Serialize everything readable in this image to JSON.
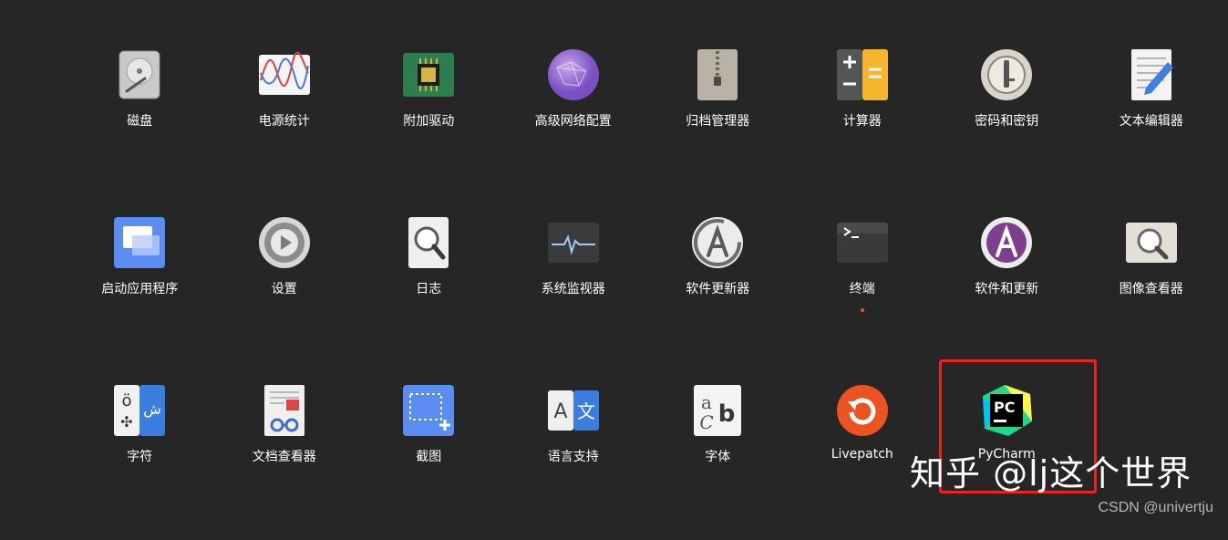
{
  "apps": [
    {
      "id": "disks",
      "label": "磁盘",
      "icon": "disk-icon"
    },
    {
      "id": "power-statistics",
      "label": "电源统计",
      "icon": "power-statistics-icon"
    },
    {
      "id": "additional-drivers",
      "label": "附加驱动",
      "icon": "chip-icon"
    },
    {
      "id": "advanced-network",
      "label": "高级网络配置",
      "icon": "network-globe-icon"
    },
    {
      "id": "archive-manager",
      "label": "归档管理器",
      "icon": "archive-zip-icon"
    },
    {
      "id": "calculator",
      "label": "计算器",
      "icon": "calculator-icon"
    },
    {
      "id": "passwords-keys",
      "label": "密码和密钥",
      "icon": "keyring-icon"
    },
    {
      "id": "text-editor",
      "label": "文本编辑器",
      "icon": "text-editor-icon"
    },
    {
      "id": "startup-apps",
      "label": "启动应用程序",
      "icon": "startup-windows-icon"
    },
    {
      "id": "settings",
      "label": "设置",
      "icon": "settings-gear-icon"
    },
    {
      "id": "logs",
      "label": "日志",
      "icon": "log-magnifier-icon"
    },
    {
      "id": "system-monitor",
      "label": "系统监视器",
      "icon": "system-monitor-icon"
    },
    {
      "id": "software-updater",
      "label": "软件更新器",
      "icon": "software-updater-icon"
    },
    {
      "id": "terminal",
      "label": "终端",
      "icon": "terminal-icon",
      "running": true
    },
    {
      "id": "software-updates",
      "label": "软件和更新",
      "icon": "software-updates-icon"
    },
    {
      "id": "image-viewer",
      "label": "图像查看器",
      "icon": "image-viewer-icon"
    },
    {
      "id": "characters",
      "label": "字符",
      "icon": "characters-icon"
    },
    {
      "id": "document-viewer",
      "label": "文档查看器",
      "icon": "document-viewer-icon"
    },
    {
      "id": "screenshot",
      "label": "截图",
      "icon": "screenshot-icon"
    },
    {
      "id": "language-support",
      "label": "语言支持",
      "icon": "language-icon"
    },
    {
      "id": "fonts",
      "label": "字体",
      "icon": "fonts-icon"
    },
    {
      "id": "livepatch",
      "label": "Livepatch",
      "icon": "livepatch-icon"
    },
    {
      "id": "pycharm",
      "label": "PyCharm",
      "icon": "pycharm-icon",
      "highlighted": true
    }
  ],
  "colors": {
    "background": "#262626",
    "highlight_border": "#e8251e",
    "running_indicator": "#e95420"
  },
  "overlays": {
    "watermark": "知乎 @lj这个世界",
    "credit": "CSDN @univertju"
  }
}
